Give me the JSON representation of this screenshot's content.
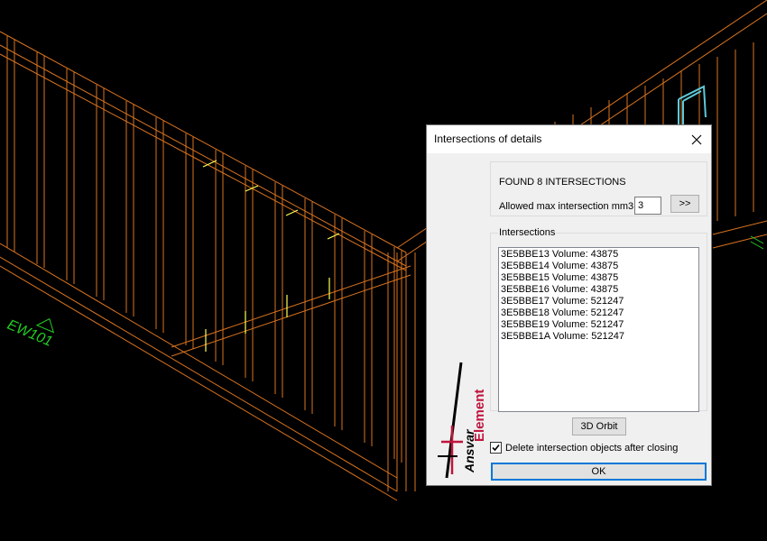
{
  "viewport": {
    "wall_label_left": "EW101",
    "colors": {
      "background": "#000000",
      "framing": "#d9731f",
      "highlight": "#ffff55",
      "label": "#22cc22",
      "window": "#5ec8d8"
    }
  },
  "dialog": {
    "title": "Intersections of details",
    "found_text": "FOUND 8 INTERSECTIONS",
    "max_label": "Allowed max intersection mm3:",
    "max_value": "3",
    "next_button": ">>",
    "group_label": "Intersections",
    "items": [
      "3E5BBE13 Volume: 43875",
      "3E5BBE14 Volume: 43875",
      "3E5BBE15 Volume: 43875",
      "3E5BBE16 Volume: 43875",
      "3E5BBE17 Volume: 521247",
      "3E5BBE18 Volume: 521247",
      "3E5BBE19 Volume: 521247",
      "3E5BBE1A Volume: 521247"
    ],
    "orbit_button": "3D Orbit",
    "delete_checkbox_label": "Delete intersection objects after closing",
    "delete_checked": true,
    "ok_button": "OK",
    "logo": {
      "text_red": "Element",
      "text_black": "Ansvar",
      "color_red": "#c0143c"
    }
  }
}
